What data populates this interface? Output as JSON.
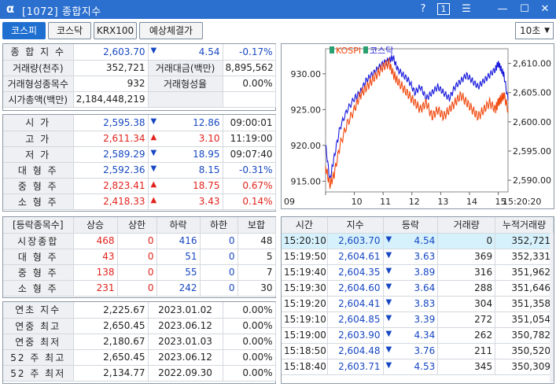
{
  "window": {
    "logo": "α",
    "title": "[1072] 종합지수",
    "help": "?",
    "one": "1",
    "menu": "☰",
    "min": "—",
    "max": "☐",
    "close": "✕"
  },
  "toolbar": {
    "tabs": [
      "코스피",
      "코스닥",
      "KRX100",
      "예상체결가"
    ],
    "interval": "10초"
  },
  "summary": {
    "r1": {
      "l1": "종 합 지 수",
      "v1": "2,603.70",
      "chg": "4.54",
      "pct": "-0.17%"
    },
    "r2": {
      "l1": "거래량(천주)",
      "v1": "352,721",
      "l2": "거래대금(백만)",
      "v2": "8,895,562"
    },
    "r3": {
      "l1": "거래형성종목수",
      "v1": "932",
      "l2": "거래형성율",
      "v2": "0.00%"
    },
    "r4": {
      "l1": "시가총액(백만)",
      "v1": "2,184,448,219"
    }
  },
  "prices": [
    {
      "label": "시 가",
      "val": "2,595.38",
      "dir": "down",
      "chg": "12.86",
      "extra": "09:00:01",
      "valc": "blue",
      "extc": "blk"
    },
    {
      "label": "고 가",
      "val": "2,611.34",
      "dir": "up",
      "chg": "3.10",
      "extra": "11:19:00",
      "valc": "red",
      "extc": "blk"
    },
    {
      "label": "저 가",
      "val": "2,589.29",
      "dir": "down",
      "chg": "18.95",
      "extra": "09:07:40",
      "valc": "blue",
      "extc": "blk"
    },
    {
      "label": "대 형 주",
      "val": "2,592.36",
      "dir": "down",
      "chg": "8.15",
      "extra": "-0.31%",
      "valc": "blue",
      "extc": "blue"
    },
    {
      "label": "중 형 주",
      "val": "2,823.41",
      "dir": "up",
      "chg": "18.75",
      "extra": "0.67%",
      "valc": "red",
      "extc": "red"
    },
    {
      "label": "소 형 주",
      "val": "2,418.33",
      "dir": "up",
      "chg": "3.43",
      "extra": "0.14%",
      "valc": "red",
      "extc": "red"
    }
  ],
  "breadth": {
    "headers": [
      "[등락종목수]",
      "상승",
      "상한",
      "하락",
      "하한",
      "보합"
    ],
    "rows": [
      {
        "label": "시장종합",
        "up": "468",
        "upl": "0",
        "dn": "416",
        "dnl": "0",
        "flat": "48"
      },
      {
        "label": "대 형 주",
        "up": "43",
        "upl": "0",
        "dn": "51",
        "dnl": "0",
        "flat": "5"
      },
      {
        "label": "중 형 주",
        "up": "138",
        "upl": "0",
        "dn": "55",
        "dnl": "0",
        "flat": "7"
      },
      {
        "label": "소 형 주",
        "up": "231",
        "upl": "0",
        "dn": "242",
        "dnl": "0",
        "flat": "30"
      }
    ]
  },
  "yearly": [
    {
      "label": "연초 지수",
      "val": "2,225.67",
      "date": "2023.01.02",
      "pct": "0.00%"
    },
    {
      "label": "연중 최고",
      "val": "2,650.45",
      "date": "2023.06.12",
      "pct": "0.00%"
    },
    {
      "label": "연중 최저",
      "val": "2,180.67",
      "date": "2023.01.03",
      "pct": "0.00%"
    },
    {
      "label": "52 주 최고",
      "val": "2,650.45",
      "date": "2023.06.12",
      "pct": "0.00%"
    },
    {
      "label": "52 주 최저",
      "val": "2,134.77",
      "date": "2022.09.30",
      "pct": "0.00%"
    }
  ],
  "ticks": {
    "headers": [
      "시간",
      "지수",
      "등락",
      "거래량",
      "누적거래량"
    ],
    "rows": [
      {
        "time": "15:20:10",
        "idx": "2,603.70",
        "chg": "4.54",
        "vol": "0",
        "cum": "352,721"
      },
      {
        "time": "15:19:50",
        "idx": "2,604.61",
        "chg": "3.63",
        "vol": "369",
        "cum": "352,331"
      },
      {
        "time": "15:19:40",
        "idx": "2,604.35",
        "chg": "3.89",
        "vol": "316",
        "cum": "351,962"
      },
      {
        "time": "15:19:30",
        "idx": "2,604.60",
        "chg": "3.64",
        "vol": "288",
        "cum": "351,646"
      },
      {
        "time": "15:19:20",
        "idx": "2,604.41",
        "chg": "3.83",
        "vol": "304",
        "cum": "351,358"
      },
      {
        "time": "15:19:10",
        "idx": "2,604.85",
        "chg": "3.39",
        "vol": "272",
        "cum": "351,054"
      },
      {
        "time": "15:19:00",
        "idx": "2,603.90",
        "chg": "4.34",
        "vol": "262",
        "cum": "350,782"
      },
      {
        "time": "15:18:50",
        "idx": "2,604.48",
        "chg": "3.76",
        "vol": "211",
        "cum": "350,520"
      },
      {
        "time": "15:18:40",
        "idx": "2,603.71",
        "chg": "4.53",
        "vol": "345",
        "cum": "350,309"
      }
    ]
  },
  "chart_data": {
    "type": "line",
    "legend": [
      "KOSPI",
      "코스닥"
    ],
    "x_ticks": [
      "09",
      "10",
      "11",
      "12",
      "13",
      "14",
      "15",
      "15:20:20"
    ],
    "y_left_ticks": [
      "930.00",
      "925.00",
      "920.00",
      "915.00"
    ],
    "y_right_ticks": [
      "2,610.00",
      "2,605.00",
      "2,600.00",
      "2,595.00",
      "2,590.00"
    ],
    "y_left_range": [
      913.5,
      933.5
    ],
    "y_right_range": [
      2588,
      2612.5
    ],
    "x_range": [
      9,
      15.34
    ],
    "series": [
      {
        "name": "KOSPI",
        "axis": "right",
        "color": "#1a1adc",
        "x": [
          9.0,
          9.15,
          9.3,
          9.5,
          9.75,
          10.0,
          10.2,
          10.4,
          10.6,
          10.8,
          11.0,
          11.2,
          11.35,
          11.5,
          11.7,
          11.9,
          12.1,
          12.3,
          12.5,
          12.7,
          12.9,
          13.1,
          13.3,
          13.5,
          13.7,
          13.9,
          14.1,
          14.3,
          14.5,
          14.7,
          14.9,
          15.0,
          15.1,
          15.2,
          15.34
        ],
        "y": [
          2596,
          2590,
          2594,
          2599,
          2602,
          2604,
          2605,
          2607,
          2608,
          2609,
          2610,
          2610.5,
          2611,
          2609,
          2608,
          2607,
          2605,
          2606,
          2604,
          2605,
          2606,
          2605,
          2604,
          2606,
          2607,
          2608,
          2607,
          2606,
          2607,
          2608,
          2609,
          2610,
          2609,
          2608,
          2603.7
        ]
      },
      {
        "name": "코스닥",
        "axis": "left",
        "color": "#f04a10",
        "x": [
          9.0,
          9.15,
          9.3,
          9.5,
          9.75,
          10.0,
          10.2,
          10.4,
          10.6,
          10.8,
          11.0,
          11.2,
          11.35,
          11.5,
          11.7,
          11.9,
          12.1,
          12.3,
          12.5,
          12.7,
          12.9,
          13.1,
          13.3,
          13.5,
          13.7,
          13.9,
          14.1,
          14.3,
          14.5,
          14.7,
          14.9,
          15.0,
          15.1,
          15.2,
          15.34
        ],
        "y": [
          917,
          914.5,
          916,
          920,
          923,
          925,
          927,
          928,
          929,
          930,
          931,
          931.5,
          930,
          929,
          928,
          927,
          926,
          925,
          926,
          924,
          925,
          924,
          925,
          926,
          927,
          926,
          925,
          924,
          925,
          926,
          925,
          926,
          926.5,
          927,
          925
        ]
      }
    ]
  }
}
